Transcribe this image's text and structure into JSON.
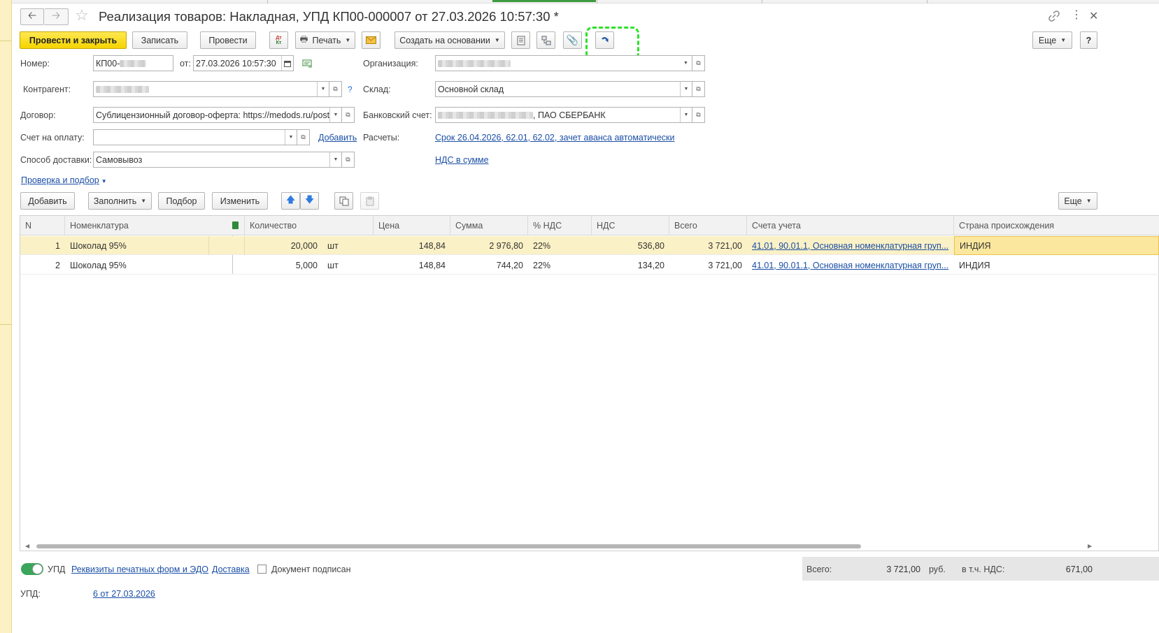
{
  "window": {
    "title": "Реализация товаров: Накладная, УПД КП00-000007 от 27.03.2026 10:57:30 *"
  },
  "toolbar": {
    "post_close": "Провести и закрыть",
    "save": "Записать",
    "post": "Провести",
    "dtkt": "Дт Кт",
    "print": "Печать",
    "create_based": "Создать на основании",
    "more": "Еще",
    "help": "?"
  },
  "form": {
    "number_label": "Номер:",
    "number_value": "КП00-",
    "from_label": "от:",
    "date_value": "27.03.2026 10:57:30",
    "org_label": "Организация:",
    "contractor_label": "Контрагент:",
    "warehouse_label": "Склад:",
    "warehouse_value": "Основной склад",
    "contract_label": "Договор:",
    "contract_value": "Сублицензионный договор-оферта: https://medods.ru/post/oferta",
    "bank_label": "Банковский счет:",
    "bank_value": ", ПАО СБЕРБАНК",
    "invoice_label": "Счет на оплату:",
    "add_link": "Добавить",
    "settlements_label": "Расчеты:",
    "settlements_link": "Срок 26.04.2026, 62.01, 62.02, зачет аванса автоматически",
    "delivery_label": "Способ доставки:",
    "delivery_value": "Самовывоз",
    "vat_link": "НДС в сумме",
    "check_link": "Проверка и подбор",
    "help_q": "?"
  },
  "table_toolbar": {
    "add": "Добавить",
    "fill": "Заполнить",
    "select": "Подбор",
    "change": "Изменить",
    "more": "Еще"
  },
  "table": {
    "columns": [
      "N",
      "Номенклатура",
      "Количество",
      "Цена",
      "Сумма",
      "% НДС",
      "НДС",
      "Всего",
      "Счета учета",
      "Страна происхождения"
    ],
    "rows": [
      {
        "n": "1",
        "name": "Шоколад 95%",
        "qty": "20,000",
        "unit": "шт",
        "price": "148,84",
        "sum": "2 976,80",
        "vat_rate": "22%",
        "vat": "536,80",
        "total": "3 721,00",
        "accounts": "41.01, 90.01.1, Основная номенклатурная груп...",
        "country": "ИНДИЯ"
      },
      {
        "n": "2",
        "name": "Шоколад 95%",
        "qty": "5,000",
        "unit": "шт",
        "price": "148,84",
        "sum": "744,20",
        "vat_rate": "22%",
        "vat": "134,20",
        "total": "3 721,00",
        "accounts": "41.01, 90.01.1, Основная номенклатурная груп...",
        "country": "ИНДИЯ"
      }
    ]
  },
  "footer": {
    "upd_label": "УПД",
    "print_forms_link": "Реквизиты печатных форм и ЭДО",
    "delivery_link": "Доставка",
    "signed_label": "Документ подписан",
    "total_label": "Всего:",
    "total_value": "3 721,00",
    "currency": "руб.",
    "vat_label": "в т.ч. НДС:",
    "vat_value": "671,00",
    "upd_row_label": "УПД:",
    "upd_row_link": "6 от 27.03.2026"
  },
  "colors": {
    "accent_yellow": "#f5d400",
    "link_blue": "#1b4fa6",
    "highlight_green": "#2fe02a",
    "selected_row": "#fbf1c6"
  }
}
